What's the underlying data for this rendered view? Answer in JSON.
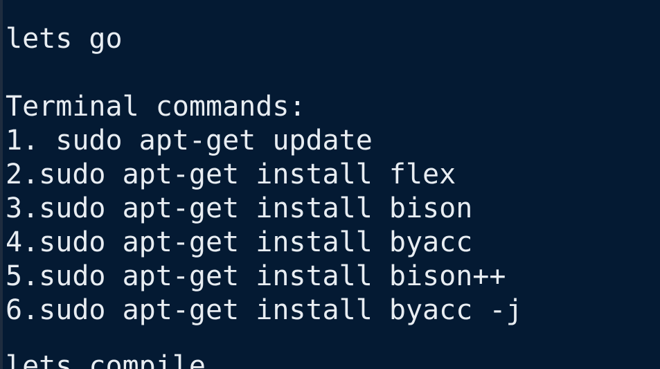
{
  "terminal": {
    "lines": [
      "lets go",
      "Terminal commands:",
      "1. sudo apt-get update",
      "2.sudo apt-get install flex",
      "3.sudo apt-get install bison",
      "4.sudo apt-get install byacc",
      "5.sudo apt-get install bison++",
      "6.sudo apt-get install byacc -j",
      "lets compile"
    ]
  },
  "colors": {
    "background": "#041a33",
    "text": "#e8edf2"
  }
}
